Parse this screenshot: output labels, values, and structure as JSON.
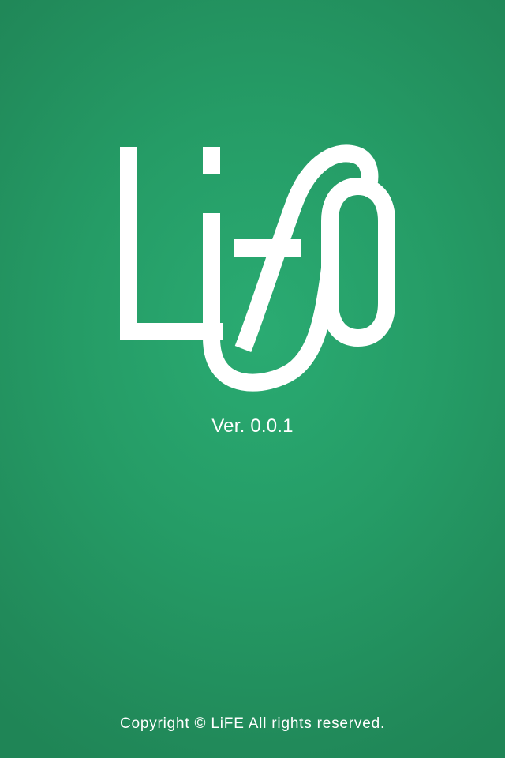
{
  "splash": {
    "logo_text": "LiFE",
    "version": "Ver. 0.0.1",
    "copyright": "Copyright © LiFE All rights reserved."
  },
  "colors": {
    "background": "#24a06a",
    "foreground": "#ffffff"
  }
}
